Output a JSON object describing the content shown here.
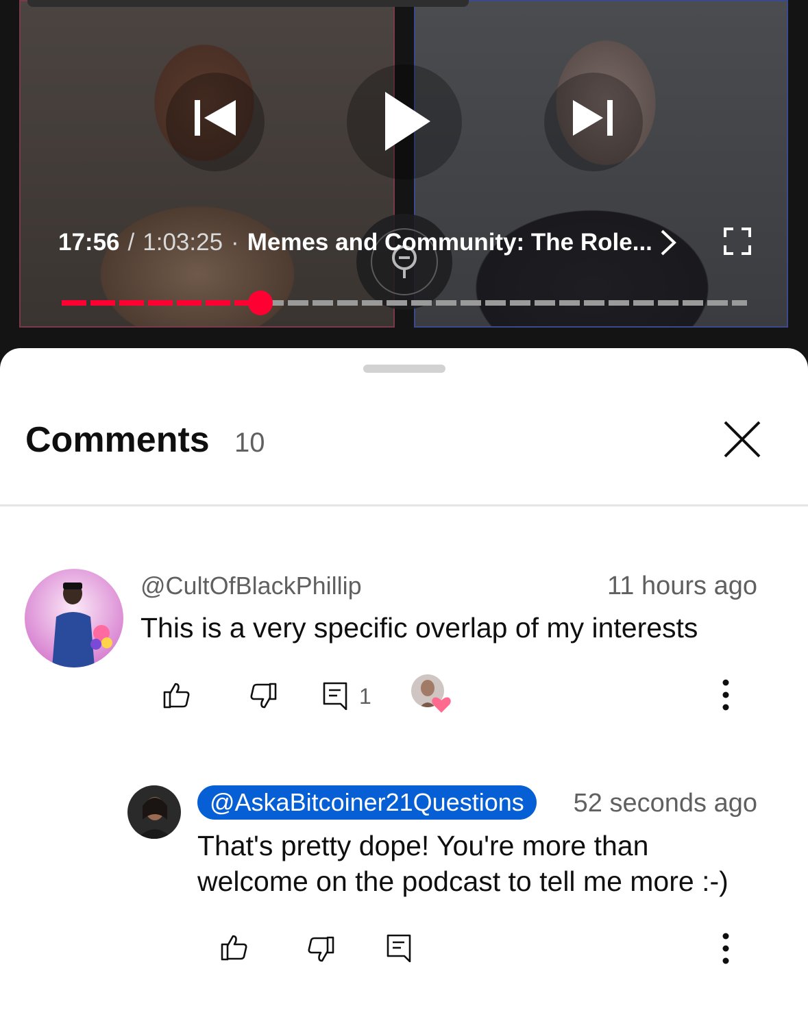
{
  "player": {
    "current_time": "17:56",
    "separator": "/",
    "total_time": "1:03:25",
    "dot": "·",
    "chapter_title": "Memes and Community: The Role...",
    "progress_fraction": 0.29,
    "colors": {
      "played": "#ff0033",
      "unplayed": "#9a9a9a"
    }
  },
  "comments_panel": {
    "title": "Comments",
    "count": "10"
  },
  "comments": [
    {
      "author": "@CultOfBlackPhillip",
      "time": "11 hours ago",
      "text": "This is a very specific overlap of my interests",
      "reply_count": "1",
      "hearted": true
    }
  ],
  "reply": {
    "author": "@AskaBitcoiner21Questions",
    "time": "52 seconds ago",
    "text": "That's pretty dope! You're more than welcome on the podcast to tell me more :-)"
  },
  "icons": {
    "previous": "skip-previous-icon",
    "play": "play-icon",
    "next": "skip-next-icon",
    "chevron": "chevron-right-icon",
    "fullscreen": "fullscreen-icon",
    "close": "close-icon",
    "like": "thumbs-up-icon",
    "dislike": "thumbs-down-icon",
    "reply": "reply-icon",
    "more": "more-vert-icon",
    "heart": "creator-heart-icon"
  }
}
